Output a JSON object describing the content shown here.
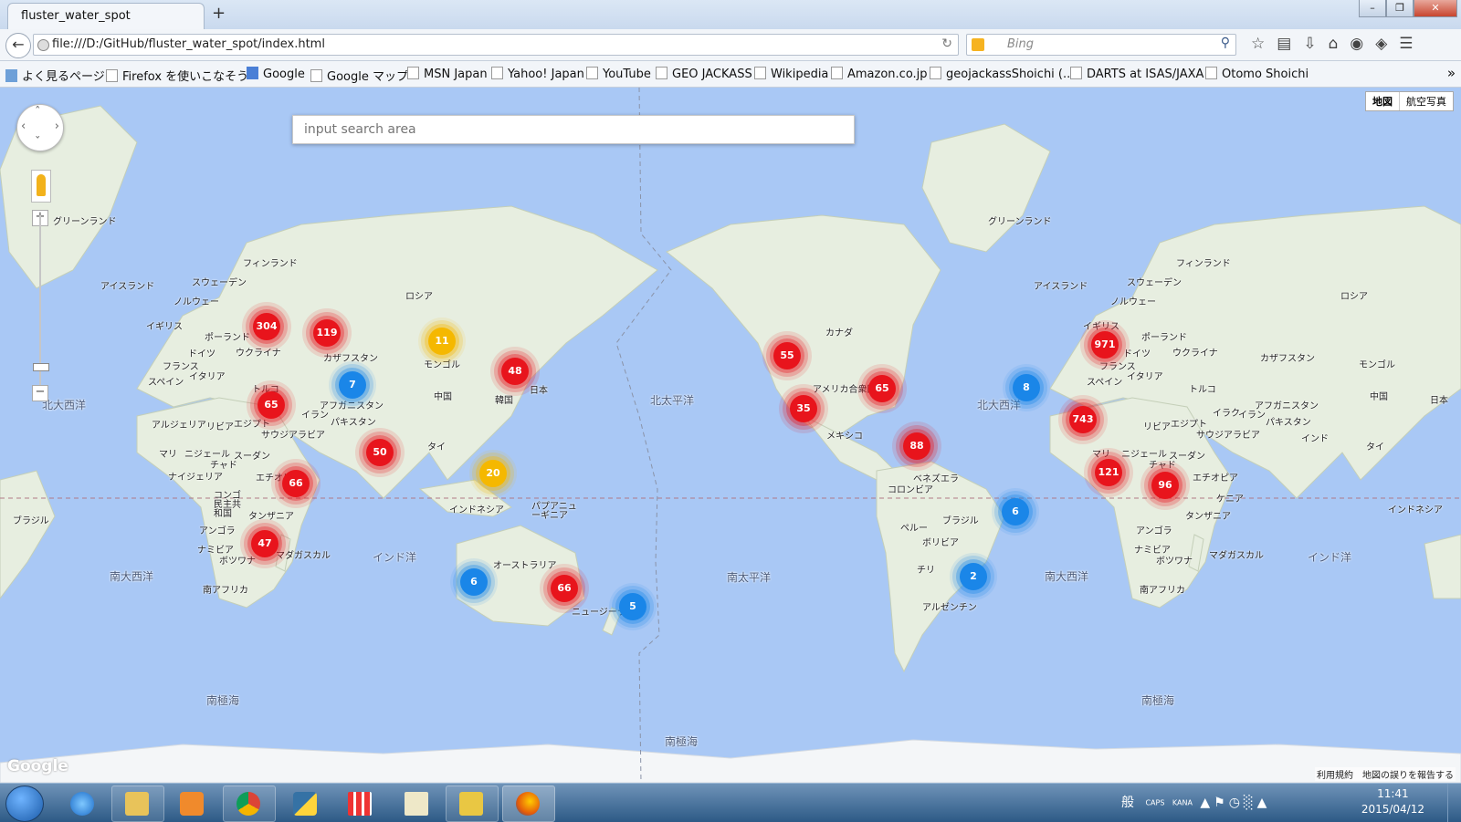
{
  "browser": {
    "tab_title": "fluster_water_spot",
    "new_tab": "+",
    "url": "file:///D:/GitHub/fluster_water_spot/index.html",
    "search_placeholder": "Bing",
    "window_buttons": [
      "–",
      "❐",
      "✕"
    ]
  },
  "bookmarks": [
    "よく見るページ",
    "Firefox を使いこなそう",
    "Google",
    "Google マップ",
    "MSN Japan",
    "Yahoo! Japan",
    "YouTube",
    "GEO JACKASS",
    "Wikipedia",
    "Amazon.co.jp",
    "geojackassShoichi (...",
    "DARTS at ISAS/JAXA",
    "Otomo Shoichi"
  ],
  "map": {
    "search_placeholder": "input search area",
    "type_buttons": [
      "地図",
      "航空写真"
    ],
    "zoom_in": "+",
    "zoom_out": "−",
    "logo": "Google",
    "terms": "利用規約　地図の誤りを報告する",
    "clusters": [
      {
        "count": "304",
        "color": "red"
      },
      {
        "count": "119",
        "color": "red"
      },
      {
        "count": "11",
        "color": "yellow"
      },
      {
        "count": "48",
        "color": "red"
      },
      {
        "count": "7",
        "color": "blue"
      },
      {
        "count": "65",
        "color": "red"
      },
      {
        "count": "50",
        "color": "red"
      },
      {
        "count": "20",
        "color": "yellow"
      },
      {
        "count": "66",
        "color": "red"
      },
      {
        "count": "47",
        "color": "red"
      },
      {
        "count": "6",
        "color": "blue"
      },
      {
        "count": "66",
        "color": "red"
      },
      {
        "count": "5",
        "color": "blue"
      },
      {
        "count": "55",
        "color": "red"
      },
      {
        "count": "65",
        "color": "red"
      },
      {
        "count": "35",
        "color": "red"
      },
      {
        "count": "88",
        "color": "red"
      },
      {
        "count": "8",
        "color": "blue"
      },
      {
        "count": "6",
        "color": "blue"
      },
      {
        "count": "2",
        "color": "blue"
      },
      {
        "count": "971",
        "color": "red"
      },
      {
        "count": "743",
        "color": "red"
      },
      {
        "count": "121",
        "color": "red"
      },
      {
        "count": "96",
        "color": "red"
      }
    ],
    "labels": {
      "greenland": "グリーンランド",
      "iceland": "アイスランド",
      "finland": "フィンランド",
      "sweden": "スウェーデン",
      "norway": "ノルウェー",
      "uk": "イギリス",
      "poland": "ポーランド",
      "ukraine": "ウクライナ",
      "germany": "ドイツ",
      "france": "フランス",
      "italy": "イタリア",
      "spain": "スペイン",
      "russia": "ロシア",
      "kazakhstan": "カザフスタン",
      "mongolia": "モンゴル",
      "china": "中国",
      "korea": "韓国",
      "japan": "日本",
      "turkey": "トルコ",
      "iran": "イラン",
      "iraq": "イラク",
      "afghanistan": "アフガニスタン",
      "pakistan": "パキスタン",
      "india": "インド",
      "thailand": "タイ",
      "saudi": "サウジアラビア",
      "egypt": "エジプト",
      "libya": "リビア",
      "algeria": "アルジェリア",
      "mali": "マリ",
      "niger": "ニジェール",
      "chad": "チャド",
      "sudan": "スーダン",
      "nigeria": "ナイジェリア",
      "ethiopia": "エチオピア",
      "kenya": "ケニア",
      "drc": "コンゴ民主共和国",
      "tanzania": "タンザニア",
      "angola": "アンゴラ",
      "namibia": "ナミビア",
      "botswana": "ボツワナ",
      "madagascar": "マダガスカル",
      "south_africa": "南アフリカ",
      "indonesia": "インドネシア",
      "png": "パプアニューギニア",
      "australia": "オーストラリア",
      "nz": "ニュージーランド",
      "canada": "カナダ",
      "usa": "アメリカ合衆国",
      "mexico": "メキシコ",
      "venezuela": "ベネズエラ",
      "colombia": "コロンビア",
      "brazil": "ブラジル",
      "peru": "ペルー",
      "bolivia": "ボリビア",
      "chile": "チリ",
      "argentina": "アルゼンチン",
      "n_pacific": "北太平洋",
      "s_pacific": "南太平洋",
      "n_atlantic": "北大西洋",
      "s_atlantic": "南大西洋",
      "indian_ocean": "インド洋",
      "southern_ocean": "南極海"
    }
  },
  "taskbar": {
    "time": "11:41",
    "date": "2015/04/12",
    "ime": "般",
    "caps": "CAPS",
    "kana": "KANA"
  },
  "colors": {
    "ocean": "#a9c8f5",
    "land": "#e7eee0",
    "cluster_red": "#e8141c",
    "cluster_blue": "#1a86e8",
    "cluster_yellow": "#f5b800"
  }
}
